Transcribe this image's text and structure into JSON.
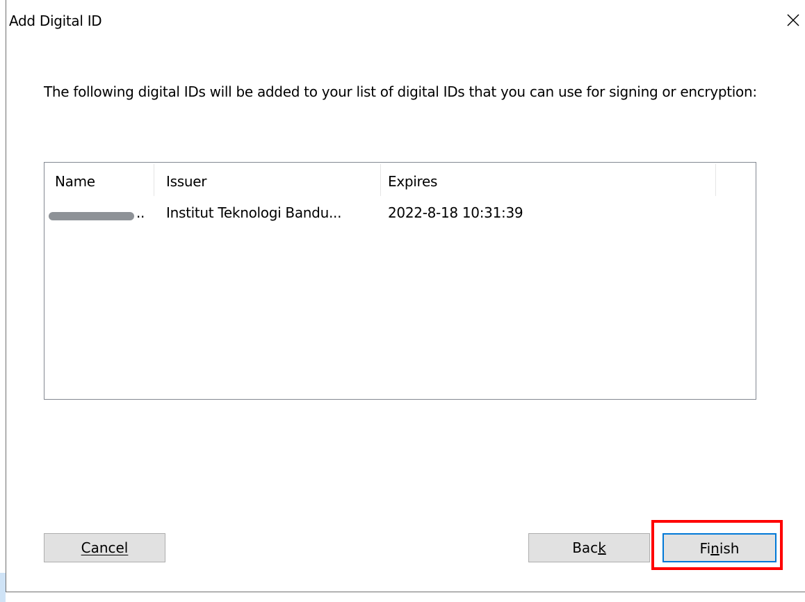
{
  "dialog": {
    "title": "Add Digital ID",
    "description": "The following digital IDs will be added to your list of digital IDs that you can use for signing or encryption:"
  },
  "table": {
    "columns": [
      "Name",
      "Issuer",
      "Expires"
    ],
    "rows": [
      {
        "name": "..",
        "issuer": "Institut Teknologi Bandu...",
        "expires": "2022-8-18 10:31:39"
      }
    ]
  },
  "buttons": {
    "cancel_label": "Cancel",
    "back_prefix": "Bac",
    "back_mnemonic": "k",
    "finish_prefix": "Fi",
    "finish_mnemonic": "n",
    "finish_suffix": "ish"
  },
  "colors": {
    "highlight": "#ff0000",
    "focus_border": "#0078d7",
    "button_bg": "#e1e1e1"
  }
}
